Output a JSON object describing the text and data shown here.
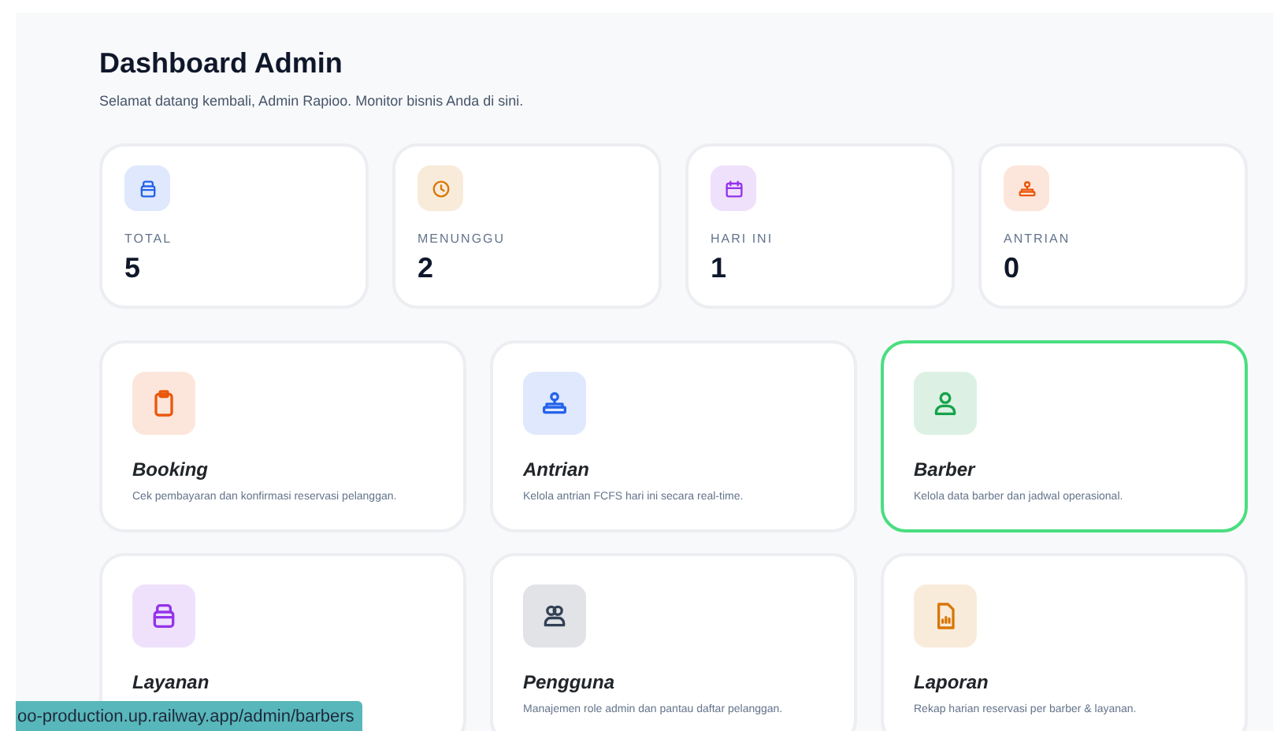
{
  "header": {
    "title": "Dashboard Admin",
    "subtitle": "Selamat datang kembali, Admin Rapioo. Monitor bisnis Anda di sini."
  },
  "stats": [
    {
      "label": "TOTAL",
      "value": "5",
      "color": "#2563eb"
    },
    {
      "label": "MENUNGGU",
      "value": "2",
      "color": "#d97706"
    },
    {
      "label": "HARI INI",
      "value": "1",
      "color": "#9333ea"
    },
    {
      "label": "ANTRIAN",
      "value": "0",
      "color": "#ea580c"
    }
  ],
  "menu": [
    {
      "title": "Booking",
      "description": "Cek pembayaran dan konfirmasi reservasi pelanggan.",
      "color": "#ea580c",
      "hovered": false
    },
    {
      "title": "Antrian",
      "description": "Kelola antrian FCFS hari ini secara real-time.",
      "color": "#2563eb",
      "hovered": false
    },
    {
      "title": "Barber",
      "description": "Kelola data barber dan jadwal operasional.",
      "color": "#16a34a",
      "hovered": true
    },
    {
      "title": "Layanan",
      "color": "#9333ea",
      "hovered": false
    },
    {
      "title": "Pengguna",
      "description": "Manajemen role admin dan pantau daftar pelanggan.",
      "color": "#334155",
      "hovered": false
    },
    {
      "title": "Laporan",
      "description": "Rekap harian reservasi per barber & layanan.",
      "color": "#d97706",
      "hovered": false
    }
  ],
  "status_bar": {
    "url": "oo-production.up.railway.app/admin/barbers"
  }
}
